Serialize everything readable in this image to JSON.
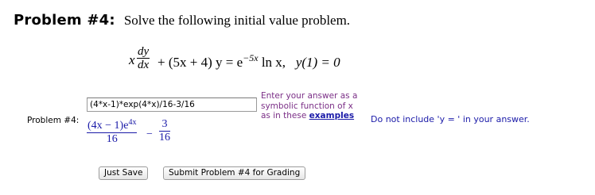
{
  "header": {
    "label": "Problem #4:",
    "instruction": "Solve the following initial value problem."
  },
  "equation": {
    "x": "x",
    "d_num": "dy",
    "d_den": "dx",
    "plus_term": "+ (5x + 4) y = e",
    "exponent": "−5x",
    "after_exp": "ln x,",
    "condition": "y(1) = 0"
  },
  "answer": {
    "side_label": "Problem #4:",
    "input_value": "(4*x-1)*exp(4*x)/16-3/16"
  },
  "preview": {
    "frac1_num": "(4x − 1)e",
    "frac1_exp": "4x",
    "frac1_den": "16",
    "minus": "−",
    "frac2_num": "3",
    "frac2_den": "16"
  },
  "hint": {
    "line1": "Enter your answer as a",
    "line2": "symbolic function of x",
    "line3_prefix": "as in these ",
    "link": "examples",
    "note": "Do not include 'y = ' in your answer."
  },
  "buttons": {
    "save": "Just Save",
    "submit": "Submit Problem #4 for Grading"
  }
}
